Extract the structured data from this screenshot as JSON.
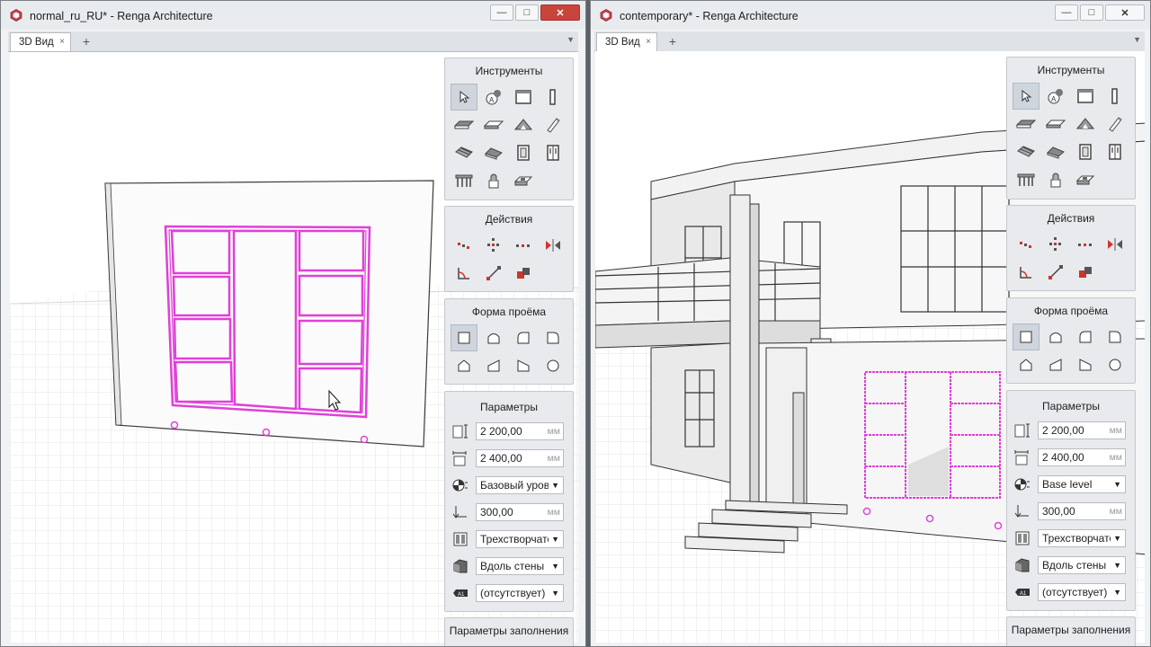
{
  "windows": [
    {
      "title": "normal_ru_RU* - Renga Architecture",
      "tab": "3D Вид",
      "tools_title": "Инструменты",
      "actions_title": "Действия",
      "shape_title": "Форма проёма",
      "params_title": "Параметры",
      "params": {
        "height": "2 200,00",
        "width": "2 400,00",
        "level": "Базовый уровень",
        "offset": "300,00",
        "style": "Трехстворчатое",
        "placement": "Вдоль стены",
        "mark": "(отсутствует)",
        "unit": "мм"
      },
      "fill_title": "Параметры заполнения"
    },
    {
      "title": "contemporary* - Renga Architecture",
      "tab": "3D Вид",
      "tools_title": "Инструменты",
      "actions_title": "Действия",
      "shape_title": "Форма проёма",
      "params_title": "Параметры",
      "params": {
        "height": "2 200,00",
        "width": "2 400,00",
        "level": "Base level",
        "offset": "300,00",
        "style": "Трехстворчатое",
        "placement": "Вдоль стены",
        "mark": "(отсутствует)",
        "unit": "мм"
      },
      "fill_title": "Параметры заполнения"
    }
  ],
  "window_controls": {
    "minimize": "—",
    "maximize": "□",
    "close": "✕"
  },
  "tab_add": "+",
  "tab_close": "×",
  "tab_menu": "▼",
  "select_arrow": "▼",
  "tool_icons": [
    "select-icon",
    "annotation-icon",
    "wall-icon",
    "column-icon",
    "slab-icon",
    "floor-icon",
    "roof-icon",
    "beam-icon",
    "stair-icon",
    "ramp-icon",
    "window-icon",
    "door-icon",
    "railing-icon",
    "equipment-icon",
    "opening-icon"
  ],
  "action_icons": [
    "move-icon",
    "rotate-copy-icon",
    "array-icon",
    "mirror-icon",
    "align-icon",
    "connect-icon",
    "join-icon"
  ],
  "shape_icons": [
    "rectangle-shape-icon",
    "arch-shape-icon",
    "corner-arch-left-icon",
    "corner-arch-right-icon",
    "pentagon-shape-icon",
    "trapezoid-left-icon",
    "trapezoid-right-icon",
    "circle-shape-icon"
  ],
  "colors": {
    "selection": "#e040d8",
    "accent_red": "#d0342c",
    "panel": "#e8eaed"
  }
}
